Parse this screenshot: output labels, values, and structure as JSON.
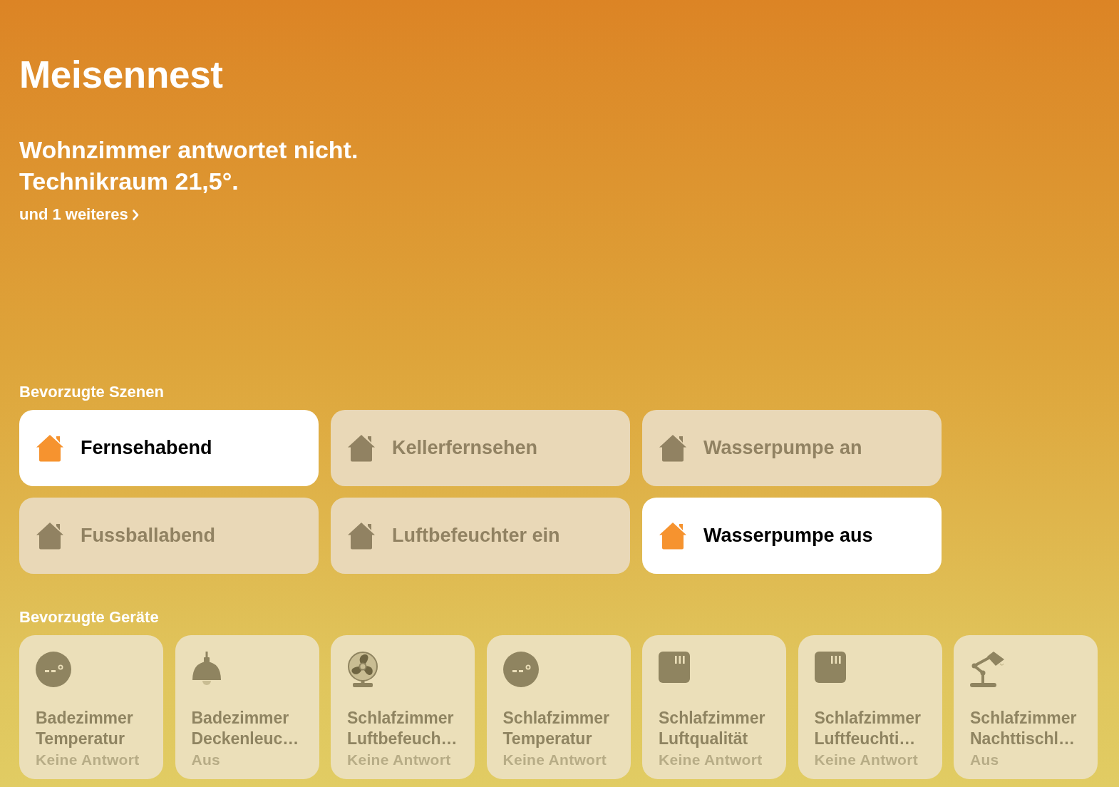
{
  "home": {
    "title": "Meisennest",
    "status_lines": [
      "Wohnzimmer antwortet nicht.",
      "Technikraum 21,5°."
    ],
    "more_link": "und 1 weiteres"
  },
  "favorite_scenes": {
    "heading": "Bevorzugte Szenen",
    "scenes": [
      {
        "label": "Fernsehabend",
        "selected": true
      },
      {
        "label": "Kellerfernsehen",
        "selected": false
      },
      {
        "label": "Wasserpumpe an",
        "selected": false
      },
      {
        "label": "Fussballabend",
        "selected": false
      },
      {
        "label": "Luftbefeuchter ein",
        "selected": false
      },
      {
        "label": "Wasserpumpe aus",
        "selected": true
      }
    ]
  },
  "favorite_accessories": {
    "heading": "Bevorzugte Geräte",
    "accessories": [
      {
        "kind": "temperature",
        "room": "Badezimmer",
        "name": "Temperatur",
        "status": "Keine Antwort"
      },
      {
        "kind": "pendant-lamp",
        "room": "Badezimmer",
        "name": "Deckenleuc…",
        "status": "Aus"
      },
      {
        "kind": "fan",
        "room": "Schlafzimmer",
        "name": "Luftbefeuch…",
        "status": "Keine Antwort"
      },
      {
        "kind": "temperature",
        "room": "Schlafzimmer",
        "name": "Temperatur",
        "status": "Keine Antwort"
      },
      {
        "kind": "air-sensor",
        "room": "Schlafzimmer",
        "name": "Luftqualität",
        "status": "Keine Antwort"
      },
      {
        "kind": "air-sensor",
        "room": "Schlafzimmer",
        "name": "Luftfeuchti…",
        "status": "Keine Antwort"
      },
      {
        "kind": "desk-lamp",
        "room": "Schlafzimmer",
        "name": "Nachttischl…",
        "status": "Aus"
      }
    ]
  }
}
